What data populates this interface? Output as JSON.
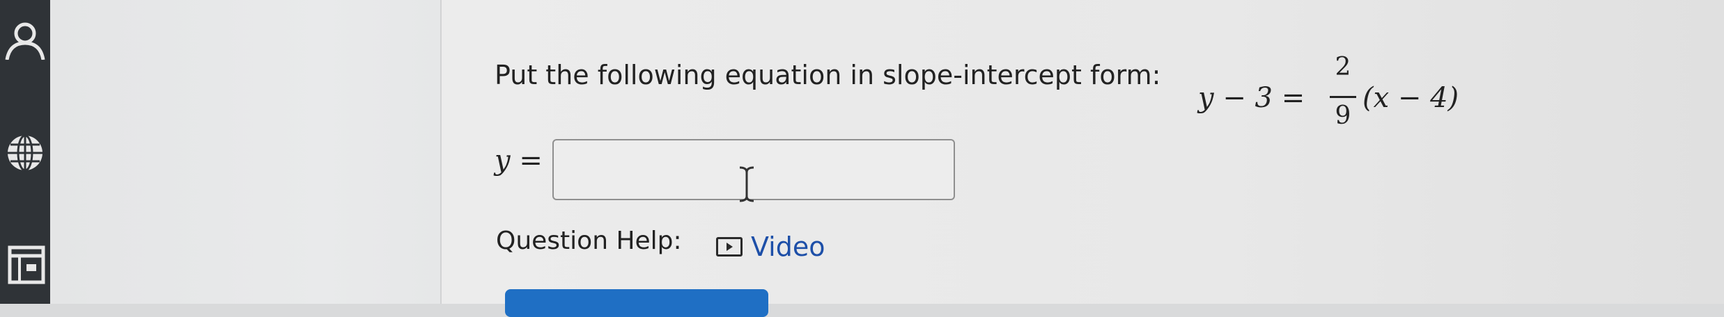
{
  "question": {
    "prompt": "Put the following equation in slope-intercept form:",
    "eq_lhs": "y − 3 =",
    "frac_num": "2",
    "frac_den": "9",
    "eq_rhs": "(x − 4)"
  },
  "answer": {
    "label": "y =",
    "value": ""
  },
  "help": {
    "label": "Question Help:",
    "video_label": "Video"
  },
  "sidebar": {
    "icons": [
      "user-icon",
      "globe-icon",
      "notebook-icon"
    ]
  },
  "colors": {
    "sidebar_bg": "#2f3337",
    "link_blue": "#1d4fa8",
    "button_blue": "#1f6fc4"
  }
}
